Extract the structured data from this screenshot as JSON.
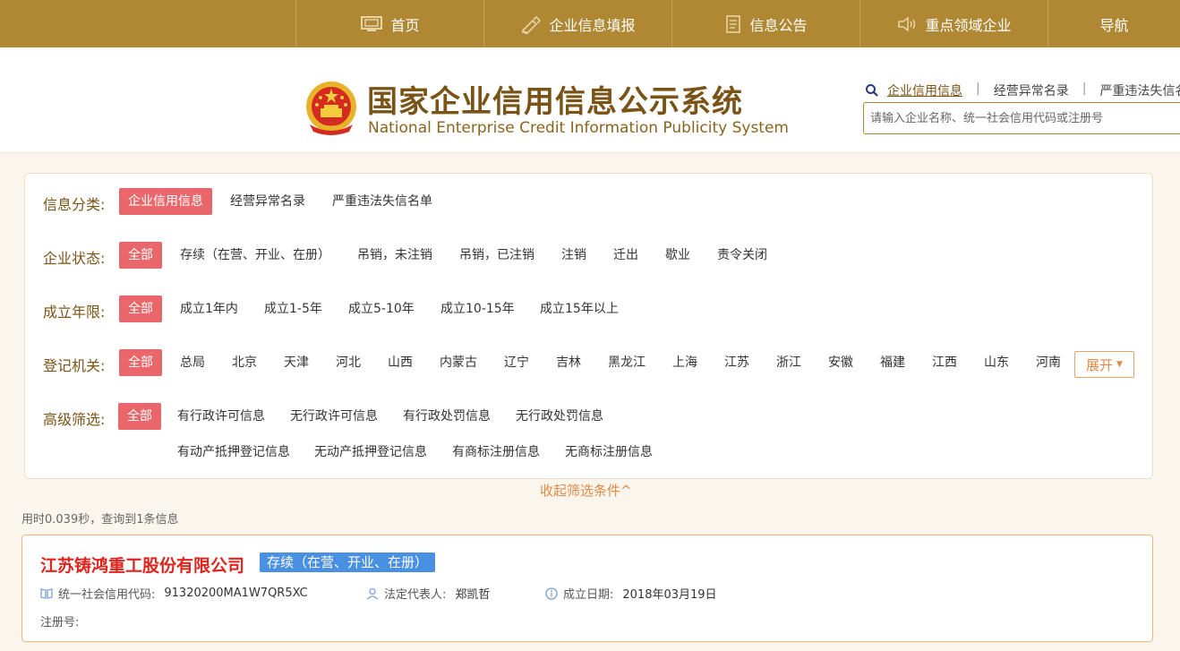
{
  "nav": {
    "items": [
      {
        "label": "首页",
        "icon": "monitor-icon"
      },
      {
        "label": "企业信息填报",
        "icon": "pen-icon"
      },
      {
        "label": "信息公告",
        "icon": "document-icon"
      },
      {
        "label": "重点领域企业",
        "icon": "speaker-icon"
      },
      {
        "label": "导航",
        "icon": ""
      }
    ],
    "bg_color": "#b08834"
  },
  "header": {
    "title_cn": "国家企业信用信息公示系统",
    "title_en": "National Enterprise Credit Information Publicity System",
    "search_tabs": [
      "企业信用信息",
      "经营异常名录",
      "严重违法失信名"
    ],
    "search_placeholder": "请输入企业名称、统一社会信用代码或注册号"
  },
  "filters": {
    "category": {
      "label": "信息分类:",
      "options": [
        "企业信用信息",
        "经营异常名录",
        "严重违法失信名单"
      ]
    },
    "status": {
      "label": "企业状态:",
      "options": [
        "全部",
        "存续（在营、开业、在册）",
        "吊销，未注销",
        "吊销，已注销",
        "注销",
        "迁出",
        "歇业",
        "责令关闭"
      ]
    },
    "years": {
      "label": "成立年限:",
      "options": [
        "全部",
        "成立1年内",
        "成立1-5年",
        "成立5-10年",
        "成立10-15年",
        "成立15年以上"
      ]
    },
    "authority": {
      "label": "登记机关:",
      "options": [
        "全部",
        "总局",
        "北京",
        "天津",
        "河北",
        "山西",
        "内蒙古",
        "辽宁",
        "吉林",
        "黑龙江",
        "上海",
        "江苏",
        "浙江",
        "安徽",
        "福建",
        "江西",
        "山东",
        "河南"
      ],
      "expand_label": "展开"
    },
    "advanced": {
      "label": "高级筛选:",
      "options": [
        "全部",
        "有行政许可信息",
        "无行政许可信息",
        "有行政处罚信息",
        "无行政处罚信息"
      ],
      "options_row2": [
        "有动产抵押登记信息",
        "无动产抵押登记信息",
        "有商标注册信息",
        "无商标注册信息"
      ]
    },
    "collapse_label": "收起筛选条件^",
    "active_color": "#e9676a"
  },
  "results": {
    "summary": "用时0.039秒，查询到1条信息",
    "items": [
      {
        "name": "江苏铸鸿重工股份有限公司",
        "status": "存续（在营、开业、在册）",
        "credit_code_label": "统一社会信用代码:",
        "credit_code": "91320200MA1W7QR5XC",
        "legal_rep_label": "法定代表人:",
        "legal_rep": "郑凯哲",
        "est_date_label": "成立日期:",
        "est_date": "2018年03月19日",
        "reg_no_label": "注册号:"
      }
    ]
  }
}
